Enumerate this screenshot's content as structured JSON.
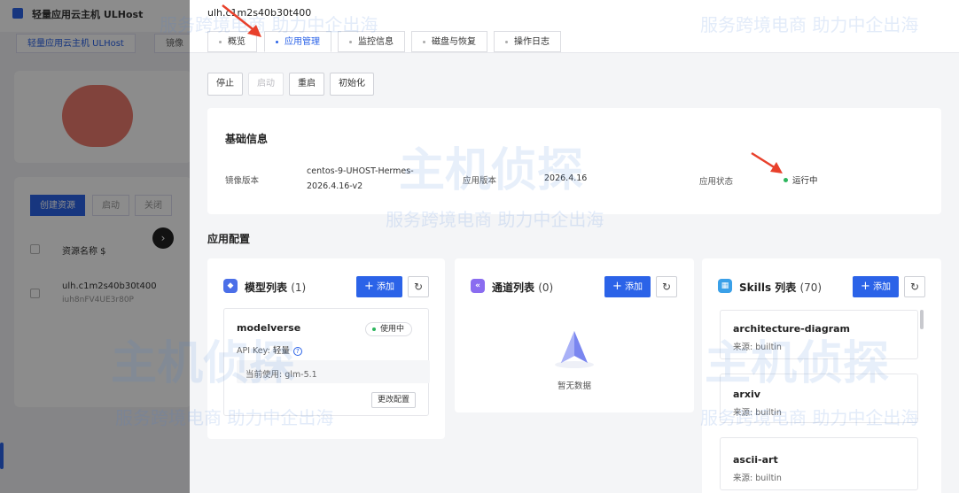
{
  "background": {
    "app_title": "轻量应用云主机 ULHost",
    "tabs": [
      "轻量应用云主机 ULHost",
      "镜像"
    ],
    "create_button": "创建资源",
    "buttons": [
      "启动",
      "关闭"
    ],
    "column_header": "资源名称 $",
    "row_name": "ulh.c1m2s40b30t400",
    "row_sub": "iuh8nFV4UE3r80P"
  },
  "drawer": {
    "instance_id": "ulh.c1m2s40b30t400",
    "tabs": [
      {
        "label": "概览",
        "active": false
      },
      {
        "label": "应用管理",
        "active": true
      },
      {
        "label": "监控信息",
        "active": false
      },
      {
        "label": "磁盘与恢复",
        "active": false
      },
      {
        "label": "操作日志",
        "active": false
      }
    ],
    "actions": {
      "stop": "停止",
      "start": "启动",
      "restart": "重启",
      "init": "初始化"
    },
    "basic_info": {
      "title": "基础信息",
      "image_version_label": "镜像版本",
      "image_version_line1": "centos-9-UHOST-Hermes-",
      "image_version_line2": "2026.4.16-v2",
      "app_version_label": "应用版本",
      "app_version_value": "2026.4.16",
      "app_status_label": "应用状态",
      "app_status_value": "运行中"
    },
    "app_config_title": "应用配置",
    "models": {
      "title": "模型列表",
      "count": "(1)",
      "add_label": "添加",
      "item": {
        "name": "modelverse",
        "status": "使用中",
        "api_key_label": "API Key:",
        "api_key_value": "轻量",
        "current_label": "当前使用:",
        "current_value": "glm-5.1",
        "edit_label": "更改配置"
      }
    },
    "channels": {
      "title": "通道列表",
      "count": "(0)",
      "add_label": "添加",
      "empty_text": "暂无数据"
    },
    "skills": {
      "title": "Skills 列表",
      "count": "(70)",
      "add_label": "添加",
      "source_label": "来源:",
      "items": [
        {
          "name": "architecture-diagram",
          "source": "builtin"
        },
        {
          "name": "arxiv",
          "source": "builtin"
        },
        {
          "name": "ascii-art",
          "source": "builtin"
        }
      ]
    }
  },
  "watermark": {
    "slogan": "服务跨境电商 助力中企出海",
    "brand": "主机侦探"
  },
  "colors": {
    "accent": "#2b63e8",
    "running": "#2db55d",
    "arrow": "#e8402b"
  }
}
